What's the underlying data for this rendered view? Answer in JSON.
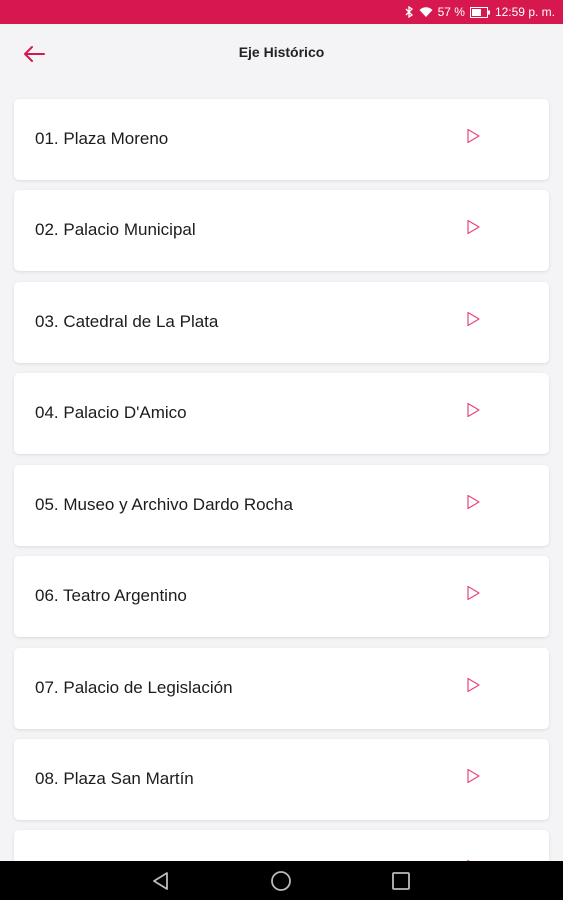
{
  "status_bar": {
    "battery_percent": "57 %",
    "time": "12:59 p. m.",
    "icons": [
      "bluetooth-icon",
      "wifi-icon",
      "battery-icon"
    ]
  },
  "header": {
    "title": "Eje Histórico",
    "back_icon": "arrow-left-icon"
  },
  "items": [
    {
      "label": "01. Plaza Moreno"
    },
    {
      "label": "02. Palacio Municipal"
    },
    {
      "label": "03. Catedral de La Plata"
    },
    {
      "label": "04. Palacio D'Amico"
    },
    {
      "label": "05. Museo y Archivo Dardo Rocha"
    },
    {
      "label": "06. Teatro Argentino"
    },
    {
      "label": "07. Palacio de Legislación"
    },
    {
      "label": "08. Plaza San Martín"
    },
    {
      "label": ""
    }
  ],
  "nav_bar": {
    "buttons": [
      "back-triangle-icon",
      "home-circle-icon",
      "recents-square-icon"
    ]
  },
  "colors": {
    "accent": "#d6184f",
    "play_icon": "#e8467a",
    "background": "#f4f4f6",
    "card": "#ffffff"
  }
}
